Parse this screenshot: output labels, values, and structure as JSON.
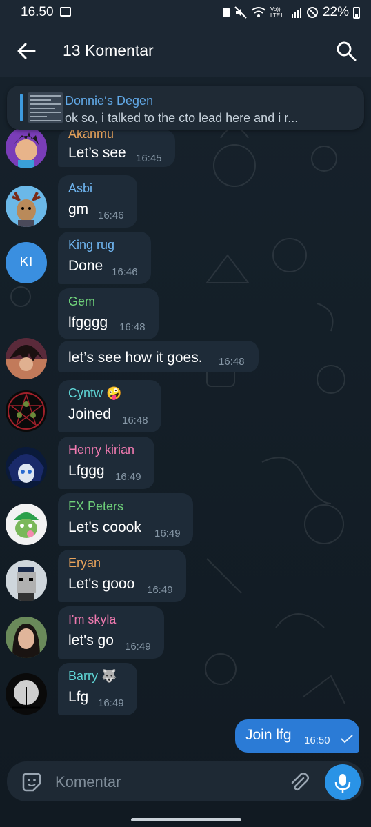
{
  "status_bar": {
    "time": "16.50",
    "battery": "22%",
    "volte": "Vo)) LTE1"
  },
  "header": {
    "title": "13 Komentar"
  },
  "pinned": {
    "title": "Donnie‘s Degen",
    "text": "ok so, i talked to the cto lead here and i r..."
  },
  "messages": [
    {
      "sender": "Akanmu",
      "text": "Let’s see",
      "time": "16:45",
      "color": "#e7a35c",
      "avatar": "cartoon-boy"
    },
    {
      "sender": "Asbi",
      "text": "gm",
      "time": "16:46",
      "color": "#6fb5f0",
      "avatar": "reindeer"
    },
    {
      "sender": "King rug",
      "text": "Done",
      "time": "16:46",
      "color": "#6fb5f0",
      "avatar": "initials",
      "initials": "KI"
    },
    {
      "sender": "Gem",
      "text": "lfgggg",
      "time": "16:48",
      "color": "#6fd17a",
      "avatar": ""
    },
    {
      "sender": "",
      "text": "let’s see how it goes.",
      "time": "16:48",
      "color": "#6fd17a",
      "avatar": "anime-guy"
    },
    {
      "sender": "Cyntw 🤪",
      "text": "Joined",
      "time": "16:48",
      "color": "#5ed4d4",
      "avatar": "pentagram"
    },
    {
      "sender": "Henry kirian",
      "text": "Lfggg",
      "time": "16:49",
      "color": "#f07ab0",
      "avatar": "anime-blue"
    },
    {
      "sender": "FX Peters",
      "text": "Let’s coook",
      "time": "16:49",
      "color": "#6fd17a",
      "avatar": "pepe-cap"
    },
    {
      "sender": "Eryan",
      "text": "Let's gooo",
      "time": "16:49",
      "color": "#e7a35c",
      "avatar": "pixel-punk"
    },
    {
      "sender": "I'm skyla",
      "text": "let's go",
      "time": "16:49",
      "color": "#f07ab0",
      "avatar": "photo-girl"
    },
    {
      "sender": "Barry 🐺",
      "text": "Lfg",
      "time": "16:49",
      "color": "#5ed4d4",
      "avatar": "moon"
    }
  ],
  "outgoing": {
    "text": "Join lfg",
    "time": "16:50"
  },
  "composer": {
    "placeholder": "Komentar"
  },
  "colors": {
    "accent": "#2a93e6",
    "outgoing_bubble": "#2b7bd6",
    "incoming_bubble": "#1e2b38"
  }
}
